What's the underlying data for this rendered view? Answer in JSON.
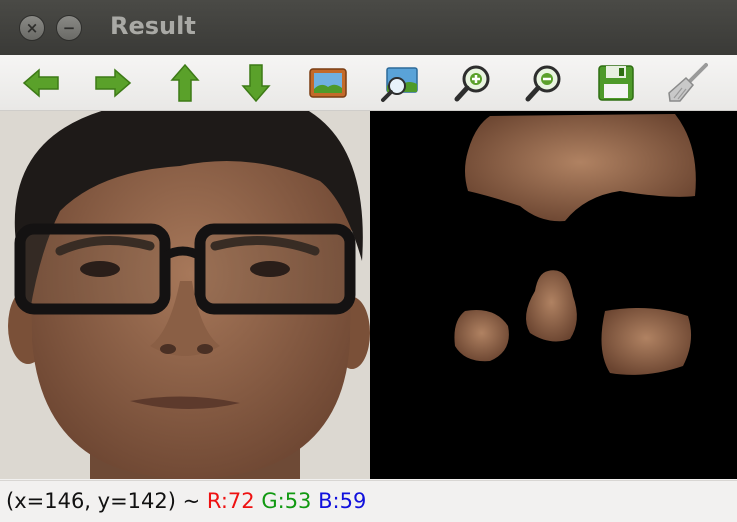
{
  "window": {
    "title": "Result",
    "close_glyph": "×",
    "minimize_glyph": "−"
  },
  "toolbar": {
    "buttons": [
      {
        "name": "pan-left-icon"
      },
      {
        "name": "pan-right-icon"
      },
      {
        "name": "pan-up-icon"
      },
      {
        "name": "pan-down-icon"
      },
      {
        "name": "zoom-fit-icon"
      },
      {
        "name": "zoom-image-icon"
      },
      {
        "name": "zoom-in-icon"
      },
      {
        "name": "zoom-out-icon"
      },
      {
        "name": "save-icon"
      },
      {
        "name": "properties-icon"
      }
    ]
  },
  "status": {
    "coords": "(x=146, y=142) ~ ",
    "r": "R:72",
    "g": "G:53",
    "b": "B:59",
    "colors": {
      "r": "#ee1111",
      "g": "#119911",
      "b": "#1111dd"
    }
  }
}
